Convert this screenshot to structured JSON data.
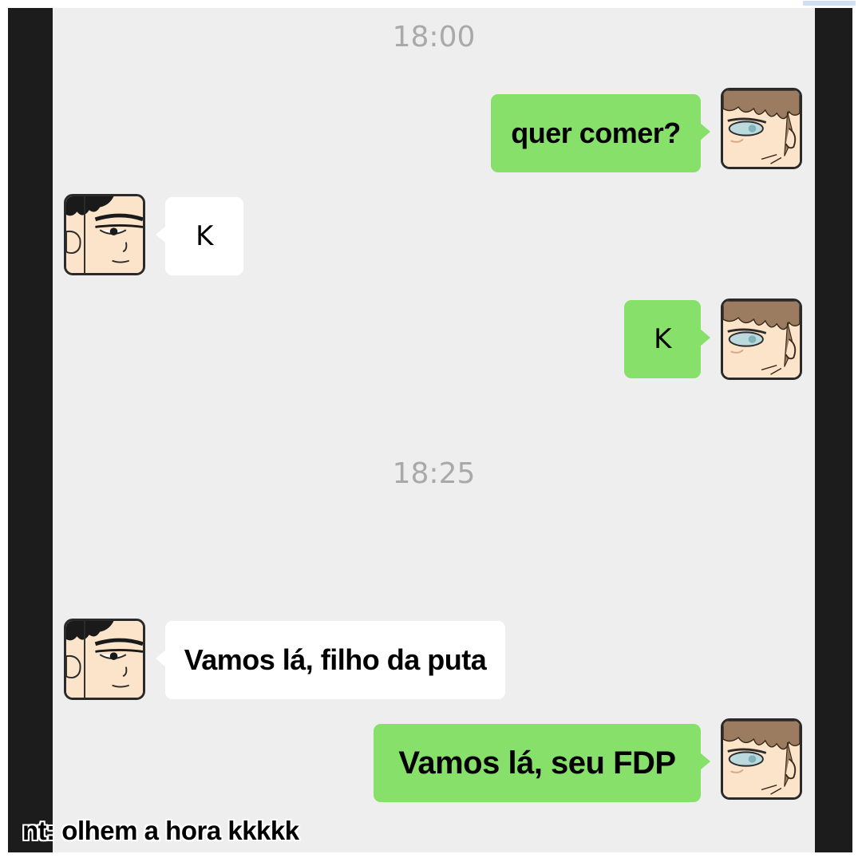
{
  "chat": {
    "timestamps": [
      "18:00",
      "18:25"
    ],
    "messages": [
      {
        "side": "right",
        "sender": "brown-hair-character",
        "text": "quer comer?"
      },
      {
        "side": "left",
        "sender": "black-hair-character",
        "text": "K"
      },
      {
        "side": "right",
        "sender": "brown-hair-character",
        "text": "K"
      },
      {
        "side": "left",
        "sender": "black-hair-character",
        "text": "Vamos lá, filho da puta"
      },
      {
        "side": "right",
        "sender": "brown-hair-character",
        "text": "Vamos lá, seu FDP"
      }
    ]
  },
  "footer_note": "nt: olhem a hora kkkkk",
  "colors": {
    "chat_background": "#eeeeee",
    "sent_bubble": "#86e06a",
    "received_bubble": "#ffffff",
    "timestamp_text": "#a9a9a9",
    "frame": "#1c1c1c"
  },
  "icons": [
    "brown-hair-avatar-icon",
    "black-hair-avatar-icon"
  ]
}
